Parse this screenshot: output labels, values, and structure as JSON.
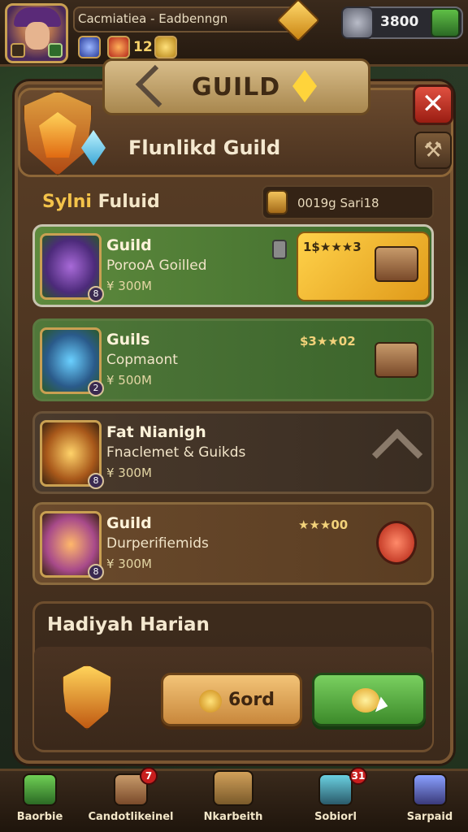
{
  "top_bar": {
    "player_name": "Cacmiatiea - Eadbenngn",
    "mini_count": "12",
    "currency_value": "3800"
  },
  "header": {
    "title": "GUILD",
    "guild_name": "Flunlikd Guild",
    "close_label": "✕",
    "tools_label": "⚒"
  },
  "section": {
    "title_highlight": "Sylni",
    "title_rest": "Fuluid",
    "coin_text": "0019g Sari18"
  },
  "cards": [
    {
      "title": "Guild",
      "subtitle": "PorooA Goilled",
      "value": "¥ 300M",
      "stars": "1$★★★3",
      "badge": "8"
    },
    {
      "title": "Guils",
      "subtitle": "Copmaont",
      "value": "¥ 500M",
      "stars": "$3★★02",
      "badge": "2"
    },
    {
      "title": "Fat Nianigh",
      "subtitle": "Fnaclemet & Guikds",
      "value": "¥ 300M",
      "stars": "",
      "badge": "8"
    },
    {
      "title": "Guild",
      "subtitle": "Durperifiemids",
      "value": "¥ 300M",
      "stars": "★★★00",
      "badge": "8"
    }
  ],
  "daily": {
    "title": "Hadiyah Harian",
    "gold_button_label": "6ord"
  },
  "bottom_nav": [
    {
      "label": "Baorbie"
    },
    {
      "label": "Candotlikeinel",
      "badge": "7"
    },
    {
      "label": "Nkarbeith"
    },
    {
      "label": "Sobiorl",
      "badge": "31"
    },
    {
      "label": "Sarpaid"
    }
  ],
  "colors": {
    "accent_gold": "#f4c34a",
    "card_green": "#4e7a38",
    "close_red": "#d03a2a"
  }
}
